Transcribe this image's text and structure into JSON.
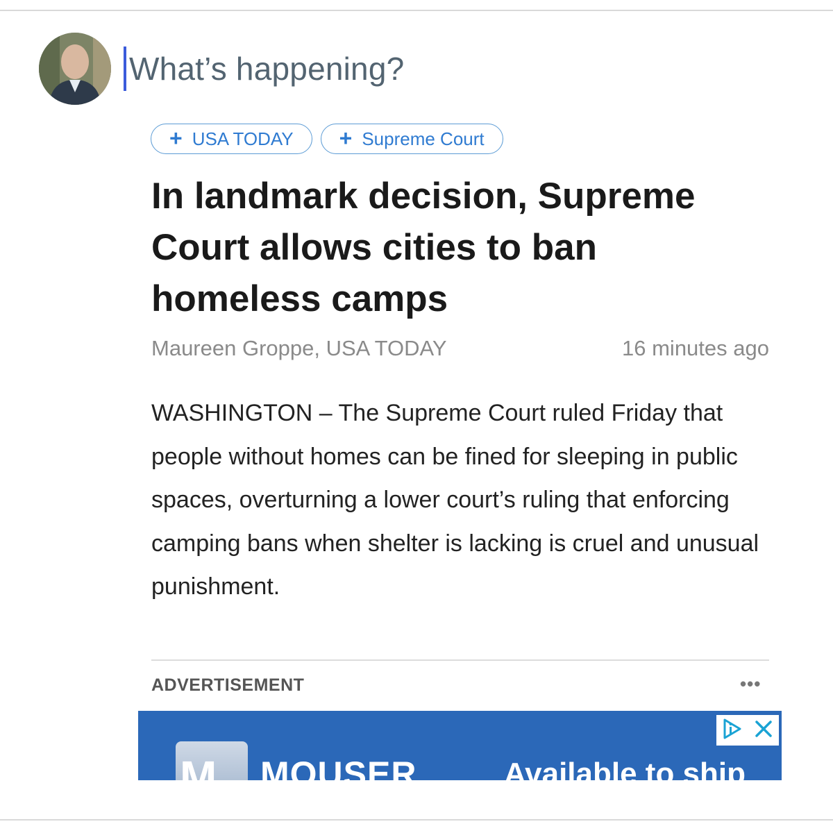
{
  "compose": {
    "placeholder": "What’s happening?"
  },
  "topics": [
    {
      "label": "USA TODAY",
      "icon": "plus-icon"
    },
    {
      "label": "Supreme Court",
      "icon": "plus-icon"
    }
  ],
  "article": {
    "headline": "In landmark decision, Supreme Court allows cities to ban homeless camps",
    "byline": "Maureen Groppe, USA TODAY",
    "timestamp": "16 minutes ago",
    "body": "WASHINGTON – The Supreme Court ruled Friday that people without homes can be fined for sleeping in public spaces, overturning a lower court’s ruling that enforcing camping bans when shelter is lacking is cruel and unusual punishment."
  },
  "advertisement": {
    "label": "ADVERTISEMENT",
    "more": "•••",
    "brand_letter": "M",
    "brand": "MOUSER",
    "tagline": "Available to ship",
    "adchoices_icon": "adchoices-icon",
    "close_icon": "close-icon",
    "banner_color": "#2b68b8"
  },
  "colors": {
    "accent": "#2f7bd1",
    "caret": "#3b5bdb",
    "placeholder": "#536471"
  }
}
